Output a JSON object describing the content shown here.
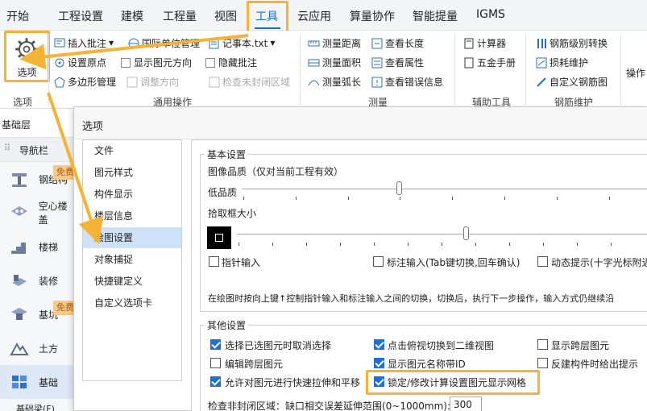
{
  "menu": {
    "items": [
      "开始",
      "工程设置",
      "建模",
      "工程量",
      "视图",
      "工具",
      "云应用",
      "算量协作",
      "智能提量",
      "IGMS"
    ],
    "active_index": 5
  },
  "ribbon": {
    "options_label": "选项",
    "groups": {
      "options": "选项",
      "general": "通用操作",
      "measure": "测量",
      "aux": "辅助工具",
      "rebar": "钢筋维护"
    },
    "general": {
      "insert_comment": "插入批注",
      "intl_units": "国际单位管理",
      "notepad": "记事本.txt",
      "set_origin": "设置原点",
      "show_direction": "显示图元方向",
      "hide_comment": "隐藏批注",
      "polygon_manage": "多边形管理",
      "adjust_direction": "调整方向",
      "check_open_area": "检查未封闭区域"
    },
    "measure": {
      "measure_distance": "测量距离",
      "measure_area": "测量面积",
      "measure_arc": "测量弧长",
      "view_length": "查看长度",
      "view_attributes": "查看属性",
      "view_errors": "查看错误信息"
    },
    "aux": {
      "calculator": "计算器",
      "hardware_manual": "五金手册"
    },
    "rebar": {
      "rebar_grade_swap": "钢筋级别转换",
      "loss_maintain": "损耗维护",
      "custom_rebar_fig": "自定义钢筋图"
    },
    "overflow_label": "操作"
  },
  "left": {
    "layer": "基础层",
    "nav": "导航栏",
    "items": [
      {
        "label": "钢结构",
        "badge": "免费"
      },
      {
        "label": "空心楼盖",
        "badge": ""
      },
      {
        "label": "楼梯",
        "badge": ""
      },
      {
        "label": "装修",
        "badge": ""
      },
      {
        "label": "基坑",
        "badge": "免费"
      },
      {
        "label": "土方",
        "badge": ""
      },
      {
        "label": "基础",
        "badge": ""
      }
    ],
    "bottom_item": "基础梁(F)",
    "selected_index": 6
  },
  "dialog": {
    "title": "选项",
    "categories": [
      "文件",
      "图元样式",
      "构件显示",
      "楼层信息",
      "绘图设置",
      "对象捕捉",
      "快捷键定义",
      "自定义选项卡"
    ],
    "selected_index": 4,
    "basic": {
      "title": "基本设置",
      "image_quality": "图像品质（仅对当前工程有效）",
      "low_quality": "低品质",
      "pick_box_size": "拾取框大小",
      "pointer_input": "指针输入",
      "dim_input": "标注输入(Tab键切换,回车确认)",
      "dynamic_tip": "动态提示(十字光标附近",
      "hint": "在绘图时按向上键↑控制指针输入和标注输入之间的切换，切换后，执行下一步操作，输入方式仍继续沿"
    },
    "other": {
      "title": "其他设置",
      "checks": [
        {
          "label": "选择已选图元时取消选择",
          "checked": true
        },
        {
          "label": "点击俯视切换到二维视图",
          "checked": true
        },
        {
          "label": "显示跨层图元",
          "checked": false
        },
        {
          "label": "编辑跨层图元",
          "checked": false
        },
        {
          "label": "显示图元名称带ID",
          "checked": true
        },
        {
          "label": "反建构件时给出提示",
          "checked": false
        },
        {
          "label": "允许对图元进行快速拉伸和平移",
          "checked": true
        },
        {
          "label": "锁定/修改计算设置图元显示网格",
          "checked": true
        }
      ],
      "range_label": "检查非封闭区域：缺口相交误差延伸范围(0~1000mm):",
      "range_value": "300"
    }
  },
  "colors": {
    "accent": "#1a6fd6",
    "highlight": "#f5b335",
    "badge": "#f8c98a"
  }
}
